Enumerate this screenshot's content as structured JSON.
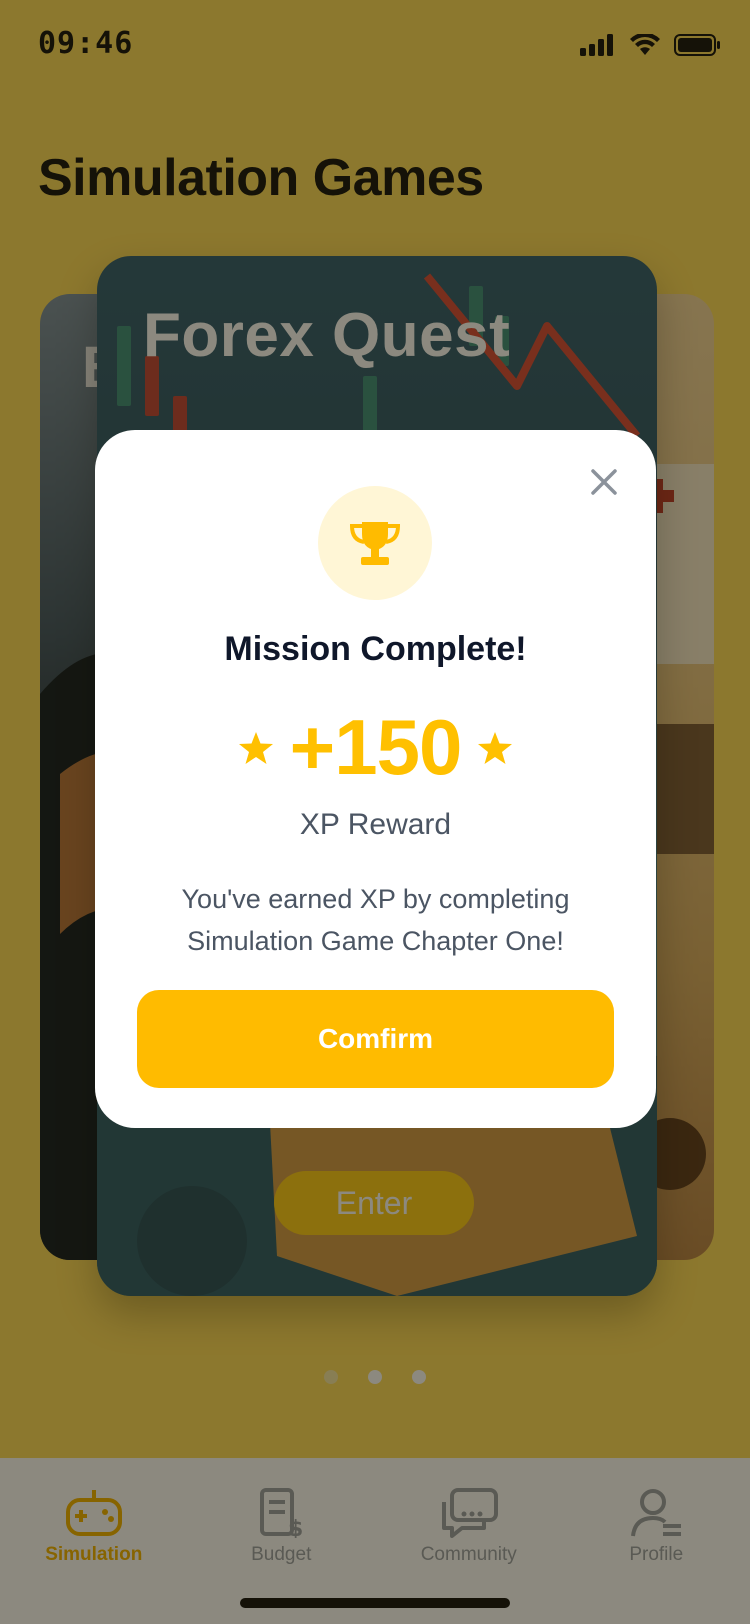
{
  "status_bar": {
    "time": "09:46"
  },
  "page": {
    "title": "Simulation Games"
  },
  "cards": {
    "left_initial": "B",
    "main_title": "Forex Quest",
    "enter_label": "Enter"
  },
  "tabs": [
    {
      "label": "Simulation",
      "icon": "gamepad-icon",
      "active": true
    },
    {
      "label": "Budget",
      "icon": "budget-document-icon",
      "active": false
    },
    {
      "label": "Community",
      "icon": "chat-bubbles-icon",
      "active": false
    },
    {
      "label": "Profile",
      "icon": "user-icon",
      "active": false
    }
  ],
  "modal": {
    "title": "Mission Complete!",
    "reward_value": "+150",
    "reward_label": "XP Reward",
    "message": "You've earned XP by completing Simulation Game Chapter One!",
    "confirm_label": "Comfirm"
  },
  "colors": {
    "accent": "#FFBB00",
    "background": "#FFDC5C",
    "trophy_bg": "#FFF6D6"
  }
}
